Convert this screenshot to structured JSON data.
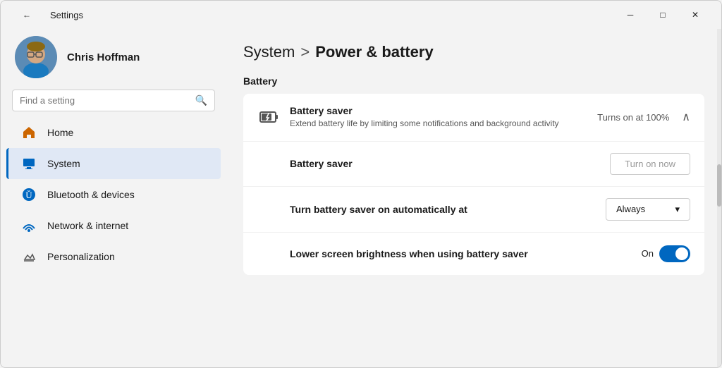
{
  "titleBar": {
    "title": "Settings",
    "minimizeLabel": "─",
    "maximizeLabel": "□",
    "closeLabel": "✕",
    "backArrow": "←"
  },
  "sidebar": {
    "user": {
      "name": "Chris Hoffman"
    },
    "search": {
      "placeholder": "Find a setting"
    },
    "navItems": [
      {
        "id": "home",
        "label": "Home",
        "iconType": "home"
      },
      {
        "id": "system",
        "label": "System",
        "iconType": "system",
        "active": true
      },
      {
        "id": "bluetooth",
        "label": "Bluetooth & devices",
        "iconType": "bluetooth"
      },
      {
        "id": "network",
        "label": "Network & internet",
        "iconType": "network"
      },
      {
        "id": "personalization",
        "label": "Personalization",
        "iconType": "personalization"
      }
    ]
  },
  "main": {
    "breadcrumbParent": "System",
    "breadcrumbSeparator": ">",
    "breadcrumbCurrent": "Power & battery",
    "sectionTitle": "Battery",
    "rows": [
      {
        "id": "battery-saver-header",
        "icon": "battery-saver",
        "title": "Battery saver",
        "description": "Extend battery life by limiting some notifications and background activity",
        "controlLabel": "Turns on at 100%",
        "hasExpand": true,
        "expandIcon": "∧"
      },
      {
        "id": "battery-saver-toggle",
        "title": "Battery saver",
        "controlType": "button",
        "buttonLabel": "Turn on now"
      },
      {
        "id": "turn-on-automatically",
        "title": "Turn battery saver on automatically at",
        "controlType": "dropdown",
        "dropdownValue": "Always",
        "dropdownIcon": "▾"
      },
      {
        "id": "lower-brightness",
        "title": "Lower screen brightness when using battery saver",
        "controlType": "toggle",
        "toggleLabel": "On",
        "toggleOn": true
      }
    ]
  }
}
